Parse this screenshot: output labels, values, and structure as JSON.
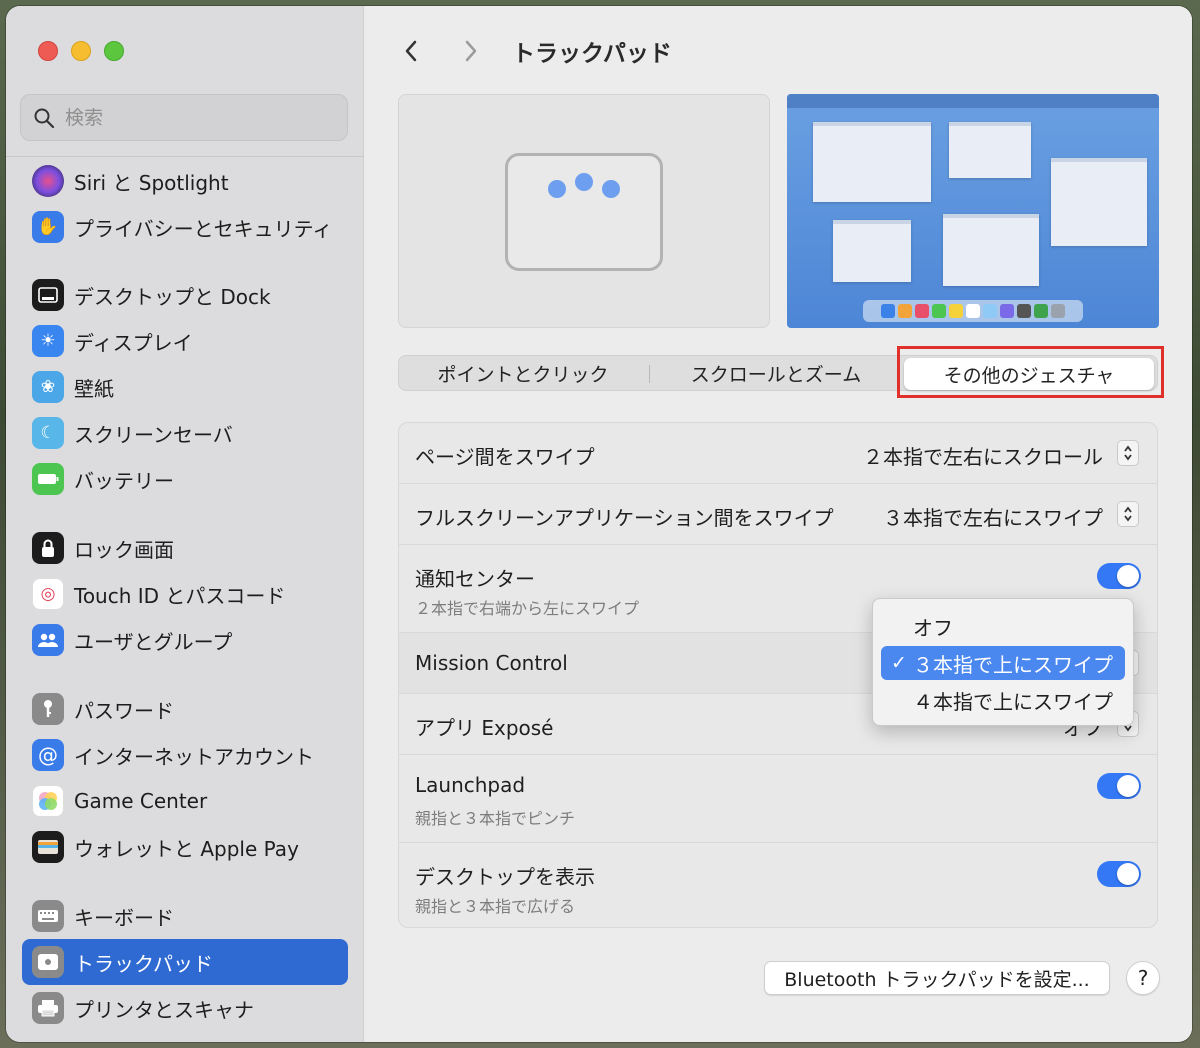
{
  "sidebar": {
    "search_placeholder": "検索",
    "items": [
      {
        "label": "Siri と Spotlight",
        "icon": "siri-icon",
        "color": "#6b4fcf"
      },
      {
        "label": "プライバシーとセキュリティ",
        "icon": "hand-icon",
        "color": "#3a7bea"
      },
      {
        "label": "デスクトップと Dock",
        "icon": "dock-icon",
        "color": "#1c1c1c"
      },
      {
        "label": "ディスプレイ",
        "icon": "sun-icon",
        "color": "#3a86f0"
      },
      {
        "label": "壁紙",
        "icon": "flower-icon",
        "color": "#4ba7e8"
      },
      {
        "label": "スクリーンセーバ",
        "icon": "screensaver-icon",
        "color": "#58b6e8"
      },
      {
        "label": "バッテリー",
        "icon": "battery-icon",
        "color": "#4cc651"
      },
      {
        "label": "ロック画面",
        "icon": "lock-icon",
        "color": "#1c1c1c"
      },
      {
        "label": "Touch ID とパスコード",
        "icon": "fingerprint-icon",
        "color": "#ffffff"
      },
      {
        "label": "ユーザとグループ",
        "icon": "users-icon",
        "color": "#3a7bea"
      },
      {
        "label": "パスワード",
        "icon": "key-icon",
        "color": "#8a8a8a"
      },
      {
        "label": "インターネットアカウント",
        "icon": "at-icon",
        "color": "#3a7bea"
      },
      {
        "label": "Game Center",
        "icon": "game-center-icon",
        "color": "#ffffff"
      },
      {
        "label": "ウォレットと Apple Pay",
        "icon": "wallet-icon",
        "color": "#1c1c1c"
      },
      {
        "label": "キーボード",
        "icon": "keyboard-icon",
        "color": "#8a8a8a"
      },
      {
        "label": "トラックパッド",
        "icon": "trackpad-icon",
        "color": "#8a8a8a"
      },
      {
        "label": "プリンタとスキャナ",
        "icon": "printer-icon",
        "color": "#8a8a8a"
      }
    ],
    "selected_index": 15
  },
  "header": {
    "title": "トラックパッド"
  },
  "tabs": [
    "ポイントとクリック",
    "スクロールとズーム",
    "その他のジェスチャ"
  ],
  "active_tab": 2,
  "settings": [
    {
      "label": "ページ間をスワイプ",
      "value": "２本指で左右にスクロール",
      "control": "popup"
    },
    {
      "label": "フルスクリーンアプリケーション間をスワイプ",
      "value": "３本指で左右にスワイプ",
      "control": "popup"
    },
    {
      "label": "通知センター",
      "sub": "２本指で右端から左にスワイプ",
      "control": "toggle",
      "on": true
    },
    {
      "label": "Mission Control",
      "control": "popup"
    },
    {
      "label": "アプリ Exposé",
      "value": "オフ",
      "control": "popup"
    },
    {
      "label": "Launchpad",
      "sub": "親指と３本指でピンチ",
      "control": "toggle",
      "on": true
    },
    {
      "label": "デスクトップを表示",
      "sub": "親指と３本指で広げる",
      "control": "toggle",
      "on": true
    }
  ],
  "popup_menu": {
    "options": [
      "オフ",
      "３本指で上にスワイプ",
      "４本指で上にスワイプ"
    ],
    "selected_index": 1,
    "check": "✓"
  },
  "footer": {
    "bluetooth_button": "Bluetooth トラックパッドを設定...",
    "help": "?"
  },
  "colors": {
    "accent": "#3478f6",
    "selection": "#2f6ad3",
    "highlight_box": "#e0302a"
  }
}
